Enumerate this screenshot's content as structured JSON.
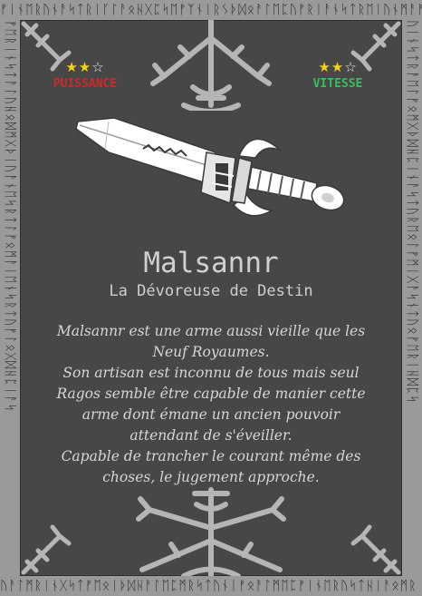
{
  "card": {
    "name": "Malsannr",
    "subtitle": "La Dévoreuse de Destin",
    "lore_lines": [
      "Malsannr est une arme aussi vieille que les",
      "Neuf Royaumes.",
      "Son artisan est inconnu de tous mais seul",
      "Ragos semble être capable de manier cette",
      "arme dont émane un ancien pouvoir",
      "attendant de s'éveiller.",
      "Capable de trancher le courant même des",
      "choses, le jugement approche."
    ]
  },
  "stats": {
    "power": {
      "label": "PUISSANCE",
      "rating": 2,
      "max": 3,
      "color": "#cf2a2a"
    },
    "speed": {
      "label": "VITESSE",
      "rating": 2,
      "max": 3,
      "color": "#34c05c"
    }
  },
  "icons": {
    "weapon": "sword-icon",
    "top_emblem": "vegvisir-icon",
    "bottom_emblem": "vegvisir-icon",
    "corners": "trident-knot-icon"
  },
  "colors": {
    "frame": "#9a9a9a",
    "panel": "#474747",
    "star_on": "#f2d21b",
    "text": "#d0d0d0"
  }
}
